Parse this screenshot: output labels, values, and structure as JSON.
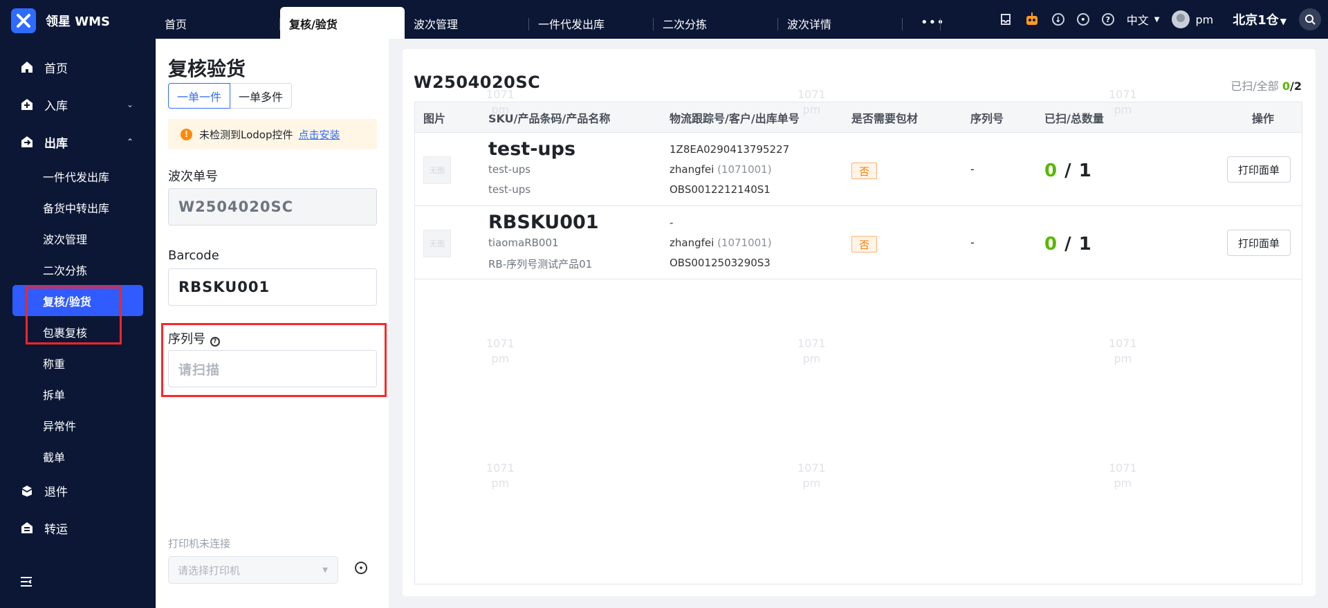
{
  "app": {
    "brand": "领星 WMS"
  },
  "top_tabs": [
    {
      "label": "首页",
      "active": false
    },
    {
      "label": "复核/验货",
      "active": true
    },
    {
      "label": "波次管理",
      "active": false
    },
    {
      "label": "一件代发出库",
      "active": false
    },
    {
      "label": "二次分拣",
      "active": false
    },
    {
      "label": "波次详情",
      "active": false
    }
  ],
  "header": {
    "more": "•••",
    "language": "中文",
    "user": "pm",
    "warehouse": "北京1仓"
  },
  "sidebar": {
    "items": [
      {
        "label": "首页"
      },
      {
        "label": "入库"
      },
      {
        "label": "出库"
      },
      {
        "label": "退件"
      },
      {
        "label": "转运"
      }
    ],
    "sub_items": [
      {
        "label": "一件代发出库"
      },
      {
        "label": "备货中转出库"
      },
      {
        "label": "波次管理"
      },
      {
        "label": "二次分拣"
      },
      {
        "label": "复核/验货",
        "active": true
      },
      {
        "label": "包裹复核"
      },
      {
        "label": "称重"
      },
      {
        "label": "拆单"
      },
      {
        "label": "异常件"
      },
      {
        "label": "截单"
      }
    ]
  },
  "left_panel": {
    "title": "复核验货",
    "mode_options": [
      "一单一件",
      "一单多件"
    ],
    "selected_mode": "一单一件",
    "notice_text": "未检测到Lodop控件",
    "notice_link": "点击安装",
    "wave_label": "波次单号",
    "wave_value": "W2504020SC",
    "barcode_label": "Barcode",
    "barcode_value": "RBSKU001",
    "serial_label": "序列号",
    "serial_placeholder": "请扫描",
    "printer_status": "打印机未连接",
    "printer_placeholder": "请选择打印机"
  },
  "main": {
    "wave_no": "W2504020SC",
    "scan_progress_label": "已扫/全部",
    "scanned": "0",
    "total": "2",
    "columns": [
      "图片",
      "SKU/产品条码/产品名称",
      "物流跟踪号/客户/出库单号",
      "是否需要包材",
      "序列号",
      "已扫/总数量",
      "操作"
    ],
    "rows": [
      {
        "image": "无图",
        "sku": "test-ups",
        "barcode": "test-ups",
        "product_name": "test-ups",
        "tracking_no": "1Z8EA0290413795227",
        "customer": "zhangfei",
        "customer_code": "(1071001)",
        "outbound_no": "OBS0012212140S1",
        "needs_packaging": "否",
        "serial": "-",
        "scanned": "0",
        "quantity": "1",
        "action": "打印面单"
      },
      {
        "image": "无图",
        "sku": "RBSKU001",
        "barcode": "tiaomaRB001",
        "product_name": "RB-序列号测试产品01",
        "tracking_no": "-",
        "customer": "zhangfei",
        "customer_code": "(1071001)",
        "outbound_no": "OBS0012503290S3",
        "needs_packaging": "否",
        "serial": "-",
        "scanned": "0",
        "quantity": "1",
        "action": "打印面单"
      }
    ]
  },
  "watermark": {
    "line1": "1071",
    "line2": "pm"
  },
  "icons": [
    "logo-icon",
    "home-icon",
    "inbound-icon",
    "outbound-icon",
    "return-icon",
    "transfer-icon",
    "collapse-icon",
    "box-icon",
    "robot-icon",
    "download-icon",
    "settings-icon",
    "help-icon",
    "search-icon",
    "warning-icon"
  ],
  "colors": {
    "accent": "#2f6bff",
    "success": "#58b800",
    "warning": "#ff7a00",
    "sidebar": "#0b1735"
  }
}
